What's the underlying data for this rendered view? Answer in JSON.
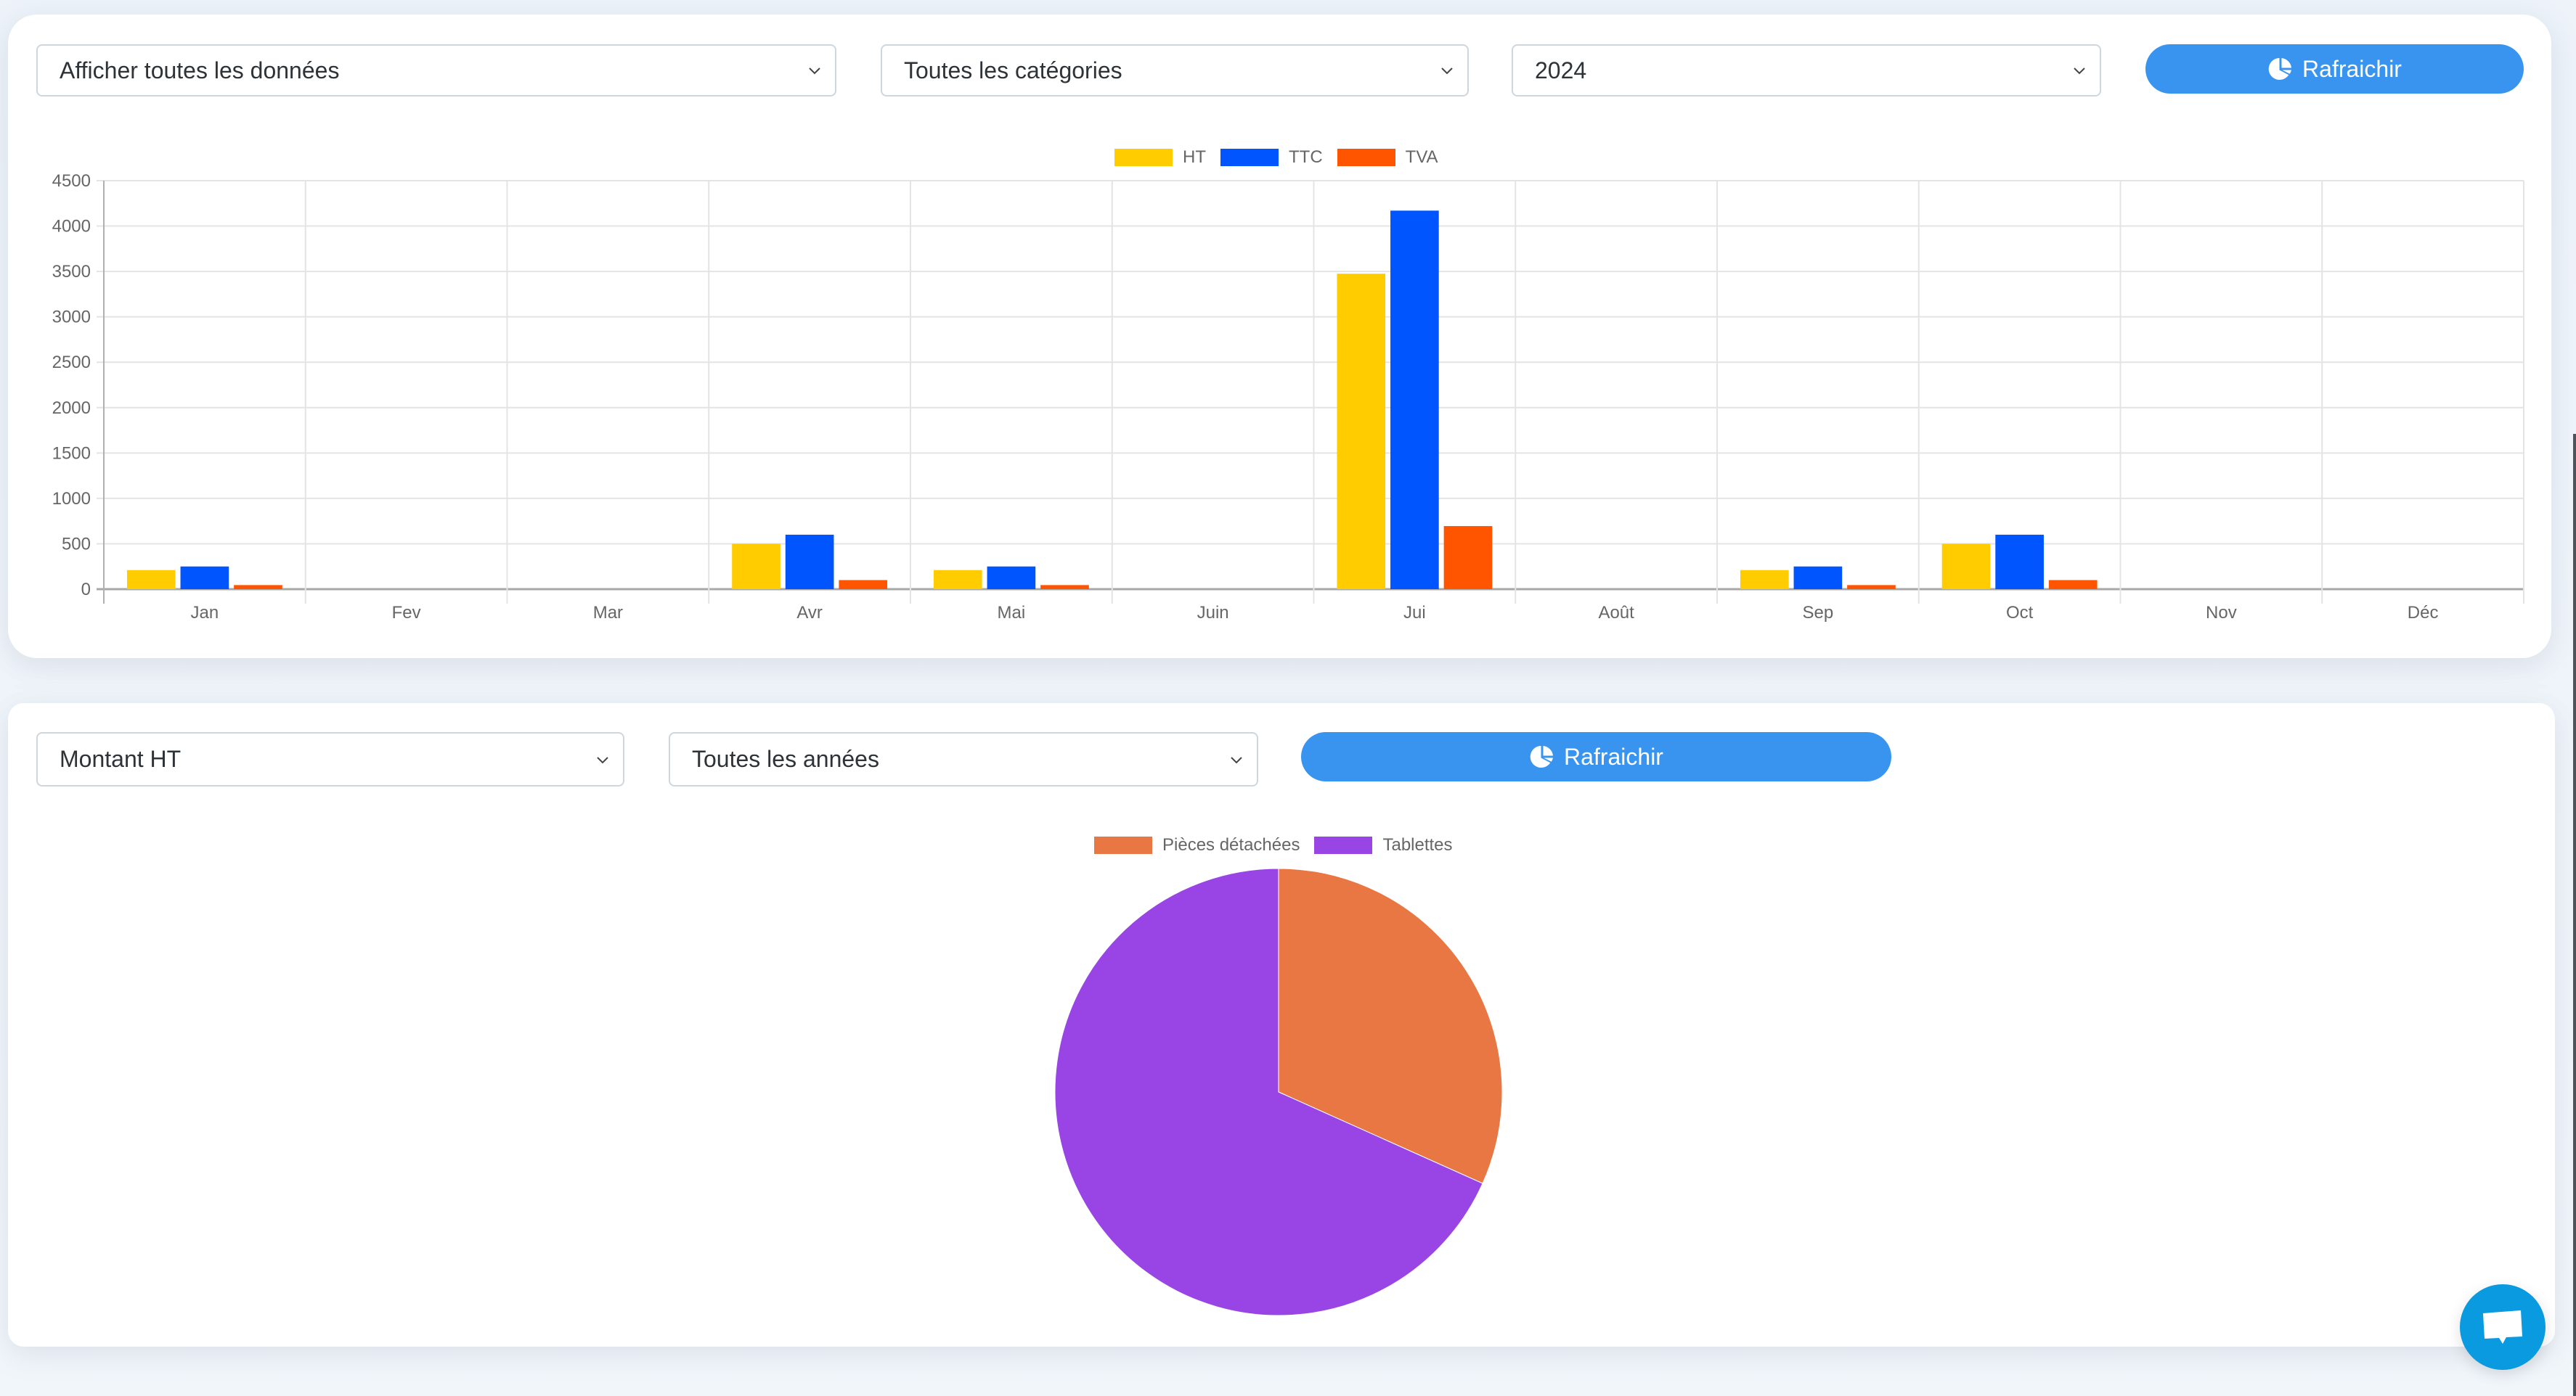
{
  "bar_panel": {
    "filters": {
      "data_select": "Afficher toutes les données",
      "category_select": "Toutes les catégories",
      "year_select": "2024"
    },
    "refresh_button": {
      "label": "Rafraichir",
      "icon": "pie-chart-icon"
    }
  },
  "pie_panel": {
    "filters": {
      "amount_select": "Montant HT",
      "year_select": "Toutes les années"
    },
    "refresh_button": {
      "label": "Rafraichir",
      "icon": "pie-chart-icon"
    }
  },
  "chat_button": {
    "icon": "chat-bubble-icon",
    "color": "#0a9ae0"
  },
  "chart_data": [
    {
      "type": "bar",
      "title": "",
      "xlabel": "",
      "ylabel": "",
      "categories": [
        "Jan",
        "Fev",
        "Mar",
        "Avr",
        "Mai",
        "Juin",
        "Jui",
        "Août",
        "Sep",
        "Oct",
        "Nov",
        "Déc"
      ],
      "series": [
        {
          "name": "HT",
          "color": "#ffcc00",
          "values": [
            210,
            0,
            0,
            500,
            210,
            0,
            3475,
            0,
            210,
            500,
            0,
            0
          ]
        },
        {
          "name": "TTC",
          "color": "#0055ff",
          "values": [
            250,
            0,
            0,
            600,
            250,
            0,
            4170,
            0,
            250,
            600,
            0,
            0
          ]
        },
        {
          "name": "TVA",
          "color": "#ff5500",
          "values": [
            45,
            0,
            0,
            100,
            45,
            0,
            695,
            0,
            45,
            100,
            0,
            0
          ]
        }
      ],
      "ylim": [
        0,
        4500
      ],
      "yticks": [
        0,
        500,
        1000,
        1500,
        2000,
        2500,
        3000,
        3500,
        4000,
        4500
      ],
      "grid": true,
      "legend": "top-center"
    },
    {
      "type": "pie",
      "title": "",
      "labels": [
        "Pièces détachées",
        "Tablettes"
      ],
      "values": [
        1625,
        3500
      ],
      "colors": [
        "#e97744",
        "#9945e6"
      ],
      "legend": "top-center"
    }
  ]
}
